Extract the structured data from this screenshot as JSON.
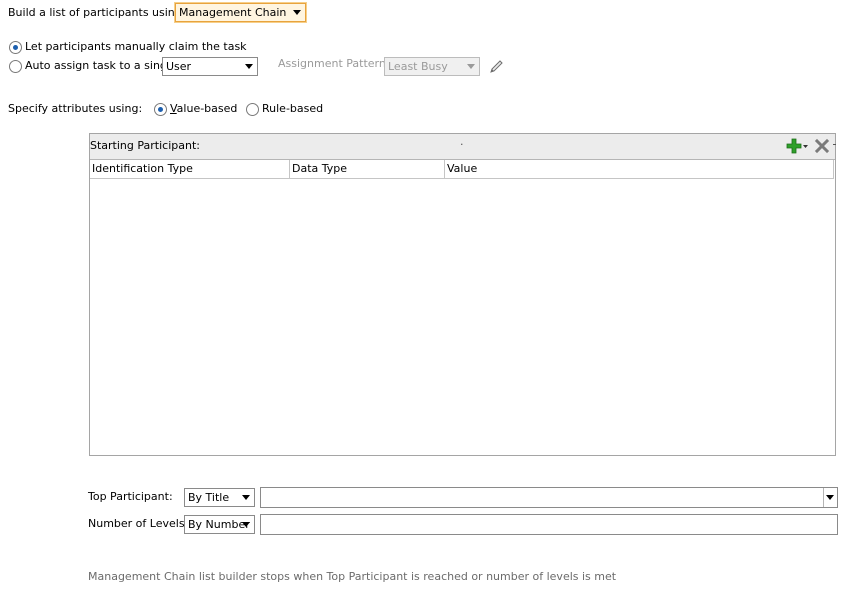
{
  "build_list": {
    "label": "Build a list of participants using:",
    "selected": "Management Chain"
  },
  "claim_option": {
    "label": "Let participants manually claim the task",
    "checked": true
  },
  "auto_assign": {
    "label": "Auto assign task to a single",
    "checked": false,
    "target_selected": "User",
    "pattern_label": "Assignment Pattern :",
    "pattern_selected": "Least Busy",
    "edit_icon": "pencil-icon"
  },
  "attributes": {
    "label": "Specify attributes using:",
    "value_based": {
      "mnemonic": "V",
      "rest": "alue-based",
      "checked": true
    },
    "rule_based": {
      "label": "Rule-based",
      "checked": false
    }
  },
  "starting_participant": {
    "title": "Starting Participant:",
    "dot": "·",
    "add_icon": "add-icon",
    "delete_icon": "delete-icon",
    "columns": [
      "Identification Type",
      "Data Type",
      "Value"
    ],
    "rows": []
  },
  "top_participant": {
    "label": "Top Participant:",
    "selected": "By Title",
    "value": ""
  },
  "levels": {
    "label": "Number of Levels:",
    "selected": "By Number",
    "value": ""
  },
  "note": "Management Chain list builder stops when Top Participant is reached or number of levels is met",
  "colors": {
    "radio_accent": "#1d5fae",
    "focus_border": "#e8a33d",
    "add_icon": "#2fa02a",
    "disabled_text": "#9a9a9a"
  }
}
